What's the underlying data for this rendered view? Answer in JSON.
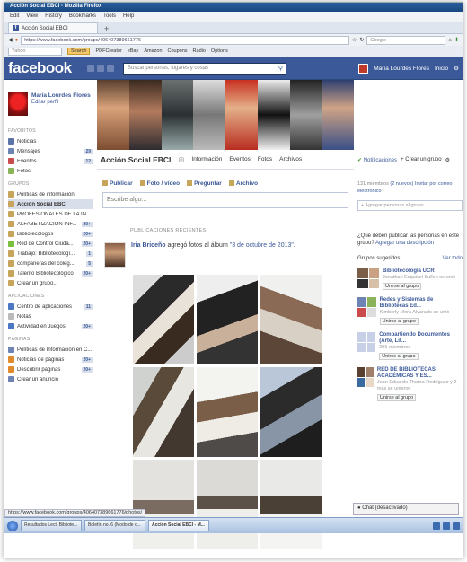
{
  "browser": {
    "window_title": "Acción Social EBCI - Mozilla Firefox",
    "menu": [
      "Edit",
      "View",
      "History",
      "Bookmarks",
      "Tools",
      "Help"
    ],
    "tab_title": "Acción Social EBCI",
    "new_tab": "+",
    "url": "https://www.facebook.com/groups/406407389661776",
    "search_placeholder": "Google",
    "yahoo_placeholder": "Yahoo",
    "search_button": "Search",
    "toolbar_items": [
      "PDFCreator",
      "eBay",
      "Amazon",
      "Coupons",
      "Radio",
      "Options"
    ],
    "status_url": "https://www.facebook.com/groups/406407389661776/photos/"
  },
  "facebook": {
    "logo": "facebook",
    "search_placeholder": "Buscar personas, lugares y cosas",
    "user_name": "María Lourdes Flores",
    "home": "Inicio"
  },
  "sidebar": {
    "profile_name": "María Lourdes Flores",
    "edit_profile": "Editar perfil",
    "sections": [
      {
        "heading": "FAVORITOS",
        "items": [
          {
            "label": "Noticias",
            "count": "",
            "color": "#5b74a8"
          },
          {
            "label": "Mensajes",
            "count": "29",
            "color": "#6d84b4"
          },
          {
            "label": "Eventos",
            "count": "12",
            "color": "#c94b4b"
          },
          {
            "label": "Fotos",
            "count": "",
            "color": "#8ab35a"
          }
        ]
      },
      {
        "heading": "GRUPOS",
        "items": [
          {
            "label": "Políticas de información",
            "count": "",
            "color": "#c7a55a"
          },
          {
            "label": "Acción Social EBCI",
            "count": "",
            "color": "#c7a55a",
            "active": true
          },
          {
            "label": "PROFESIONALES DE LA INF...",
            "count": "",
            "color": "#c7a55a"
          },
          {
            "label": "ALFABETIZACIÓN INF...",
            "count": "20+",
            "color": "#c7a55a"
          },
          {
            "label": "Bibliotecólogos",
            "count": "20+",
            "color": "#c7a55a"
          },
          {
            "label": "Red de Control Ciuda...",
            "count": "20+",
            "color": "#7bbf3f"
          },
          {
            "label": "Trabajo: Bibliotecólogí...",
            "count": "1",
            "color": "#c7a55a"
          },
          {
            "label": "compañeras del coleg...",
            "count": "5",
            "color": "#c7a55a"
          },
          {
            "label": "Talento Bibliotecológico",
            "count": "20+",
            "color": "#c7a55a"
          },
          {
            "label": "Crear un grupo...",
            "count": "",
            "color": "#c7a55a"
          }
        ]
      },
      {
        "heading": "APLICACIONES",
        "items": [
          {
            "label": "Centro de aplicaciones",
            "count": "11",
            "color": "#4a78c2"
          },
          {
            "label": "Notas",
            "count": "",
            "color": "#bbb"
          },
          {
            "label": "Actividad en Juegos",
            "count": "20+",
            "color": "#4a78c2"
          }
        ]
      },
      {
        "heading": "PÁGINAS",
        "items": [
          {
            "label": "Políticas de Información en C...",
            "count": "",
            "color": "#6d84b4"
          },
          {
            "label": "Noticias de páginas",
            "count": "20+",
            "color": "#e08a2c"
          },
          {
            "label": "Descubrir páginas",
            "count": "20+",
            "color": "#e08a2c"
          },
          {
            "label": "Crear un anuncio",
            "count": "",
            "color": "#6d84b4"
          }
        ]
      }
    ]
  },
  "group": {
    "name": "Acción Social EBCI",
    "tabs": [
      "Información",
      "Eventos",
      "Fotos",
      "Archivos"
    ],
    "notifications": "Notificaciones",
    "create_group": "+ Crear un grupo",
    "composer_actions": [
      "Publicar",
      "Foto / vídeo",
      "Preguntar",
      "Archivo"
    ],
    "composer_placeholder": "Escribe algo...",
    "recent_heading": "PUBLICACIONES RECIENTES",
    "post": {
      "author": "Iria Briceño",
      "action": " agregó fotos al álbum ",
      "album": "\"3 de octubre de 2013\"",
      "suffix": "."
    }
  },
  "right": {
    "members": "131 miembros",
    "new_count": "(2 nuevos)",
    "invite": "Invitar por correo electrónico",
    "add_people": "+ Agregar personas al grupo",
    "question": "¿Qué deben publicar las personas en este grupo?",
    "add_desc": "Agregar una descripción",
    "suggested": "Grupos sugeridos",
    "see_all": "Ver todo",
    "join": "Unirse al grupo",
    "suggestions": [
      {
        "name": "Bibliotecología UCR",
        "sub": "Jonathan Esquivel Sullen se unió"
      },
      {
        "name": "Redes y Sistemas de Bibliotecas Ed...",
        "sub": "Kimberly Mora Alvarado se unió"
      },
      {
        "name": "Compartiendo Documentos (Arte, Lit...",
        "sub": "296 miembros"
      },
      {
        "name": "RED DE BIBLIOTECAS ACADÉMICAS Y ES...",
        "sub": "Juan Eduardo Thaína Rodríguez y 2 más se unieron"
      }
    ],
    "chat": "Chat (desactivado)"
  },
  "taskbar": [
    "Resultados Lect. Bibliote...",
    "Boletín no. 6 (Modo de c...",
    "Acción Social EBCI - M..."
  ]
}
